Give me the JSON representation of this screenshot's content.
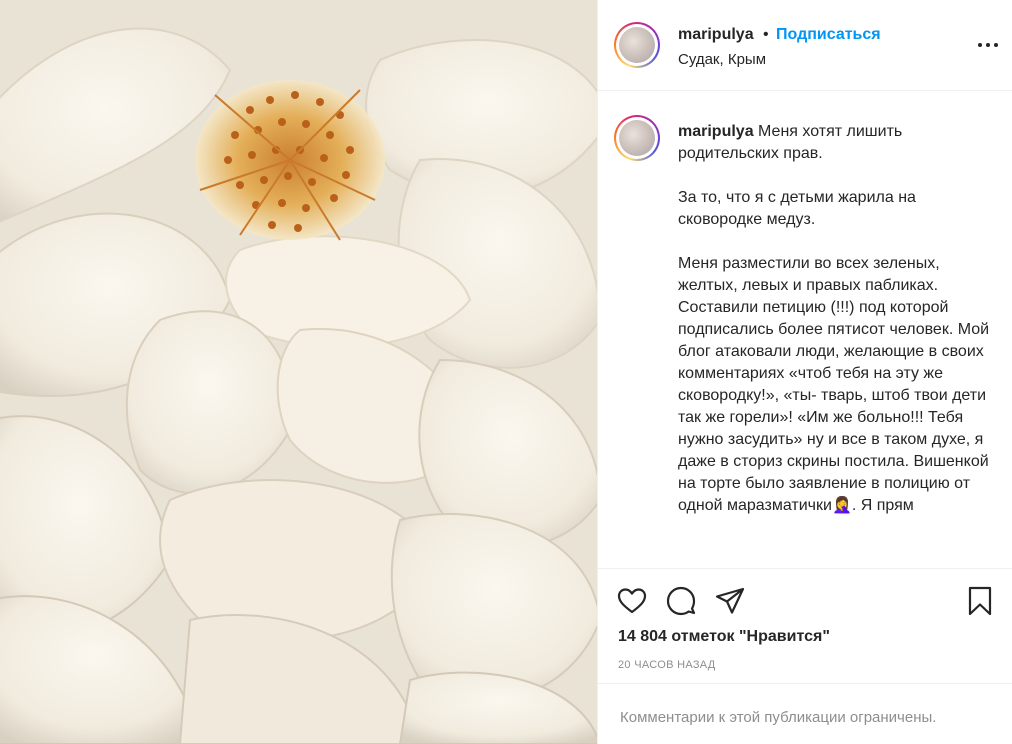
{
  "post": {
    "image_subject": "flower-photo",
    "header": {
      "username": "maripulya",
      "dot": "•",
      "follow_label": "Подписаться",
      "location": "Судак, Крым"
    },
    "caption": {
      "username": "maripulya",
      "paragraphs": [
        "Меня хотят лишить родительских прав.",
        "За то, что я с детьми жарила на сковородке медуз.",
        "Меня разместили во всех зеленых, желтых, левых и правых пабликах. Составили петицию (!!!) под которой подписались более пятисот человек. Мой блог атаковали люди, желающие в своих комментариях «чтоб тебя на эту же сковородку!», «ты- тварь, штоб твои дети так же горели»! «Им же больно!!! Тебя нужно засудить» ну и все в таком духе, я даже в сториз скрины постила. Вишенкой на торте было заявление в полицию от одной маразматички🤦‍♀️. Я прям"
      ]
    },
    "likes_text": "14 804 отметок \"Нравится\"",
    "time_text": "20 ЧАСОВ НАЗАД",
    "comments_notice": "Комментарии к этой публикации ограничены.",
    "colors": {
      "accent": "#0095f6",
      "text": "#262626",
      "muted": "#8e8e8e"
    },
    "icons": [
      "more-options-icon",
      "heart-icon",
      "comment-icon",
      "share-icon",
      "bookmark-icon"
    ]
  }
}
